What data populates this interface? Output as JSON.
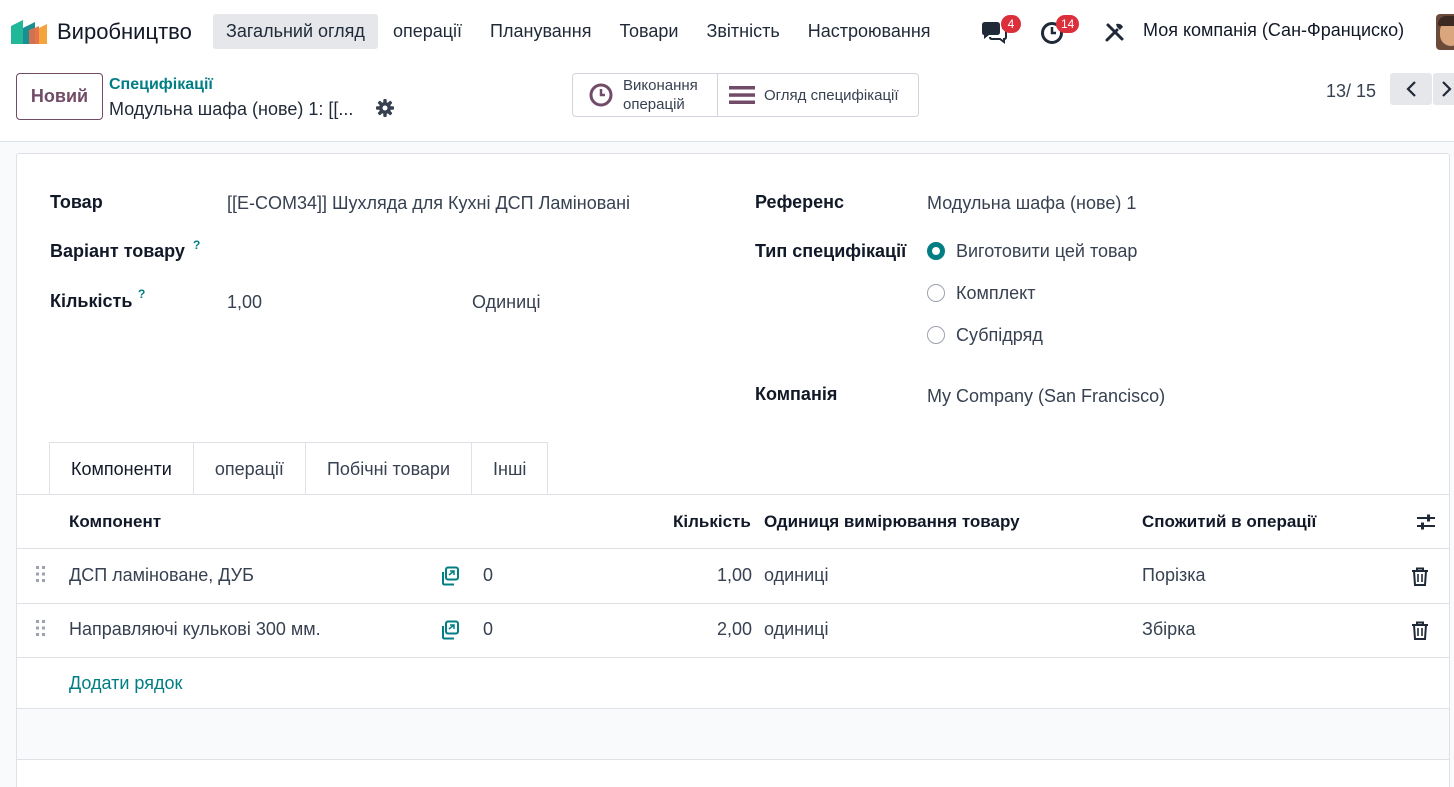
{
  "topbar": {
    "app_title": "Виробництво",
    "menu": [
      "Загальний огляд",
      "операції",
      "Планування",
      "Товари",
      "Звітність",
      "Настроювання"
    ],
    "messages_badge": "4",
    "activities_badge": "14",
    "company": "Моя компанія (Сан-Франциско)",
    "colors": {
      "badge": "#dc2f3c",
      "active_menu_bg": "#e5e7eb"
    }
  },
  "control": {
    "new_button": "Новий",
    "breadcrumb_parent": "Специфікації",
    "record_name": "Модульна шафа (нове) 1: [[...",
    "smart_buttons": {
      "operations_line1": "Виконання",
      "operations_line2": "операцій",
      "overview": "Огляд специфікації"
    },
    "pager": "13/ 15"
  },
  "form": {
    "product_label": "Товар",
    "product_value": "[[E-COM34]] Шухляда для Кухні ДСП Ламіновані",
    "variant_label": "Варіант товару",
    "quantity_label": "Кількість",
    "quantity_value": "1,00",
    "quantity_uom": "Одиниці",
    "help_mark": "?",
    "reference_label": "Референс",
    "reference_value": "Модульна шафа (нове) 1",
    "bom_type_label": "Тип специфікації",
    "bom_type_options": [
      "Виготовити цей товар",
      "Комплект",
      "Субпідряд"
    ],
    "bom_type_selected": "Виготовити цей товар",
    "company_label": "Компанія",
    "company_value": "My Company (San Francisco)"
  },
  "tabs": [
    "Компоненти",
    "операції",
    "Побічні товари",
    "Інші"
  ],
  "components_table": {
    "headers": {
      "component": "Компонент",
      "quantity": "Кількість",
      "uom": "Одиниця вимірювання товару",
      "operation": "Спожитий в операції"
    },
    "rows": [
      {
        "component": "ДСП ламіноване, ДУБ",
        "avail": "0",
        "quantity": "1,00",
        "uom": "одиниці",
        "operation": "Порізка"
      },
      {
        "component": "Направляючі кулькові 300 мм.",
        "avail": "0",
        "quantity": "2,00",
        "uom": "одиниці",
        "operation": "Збірка"
      }
    ],
    "add_line": "Додати рядок"
  },
  "accent_color": "#017e84",
  "brand_color": "#714b67"
}
